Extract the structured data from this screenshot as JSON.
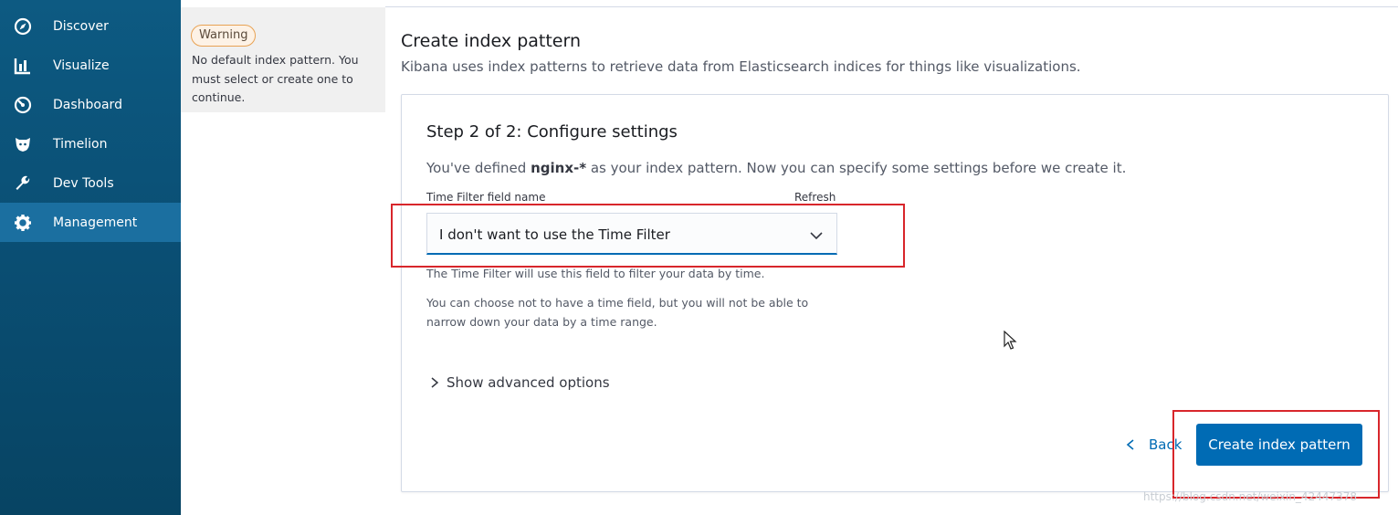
{
  "sidebar": {
    "items": [
      {
        "label": "Discover",
        "icon": "compass-icon",
        "active": false
      },
      {
        "label": "Visualize",
        "icon": "bar-chart-icon",
        "active": false
      },
      {
        "label": "Dashboard",
        "icon": "dashboard-icon",
        "active": false
      },
      {
        "label": "Timelion",
        "icon": "timelion-icon",
        "active": false
      },
      {
        "label": "Dev Tools",
        "icon": "wrench-icon",
        "active": false
      },
      {
        "label": "Management",
        "icon": "gear-icon",
        "active": true
      }
    ]
  },
  "warning": {
    "badge": "Warning",
    "message": "No default index pattern. You must select or create one to continue."
  },
  "header": {
    "title": "Create index pattern",
    "subtitle": "Kibana uses index patterns to retrieve data from Elasticsearch indices for things like visualizations."
  },
  "step": {
    "title": "Step 2 of 2: Configure settings",
    "desc_prefix": "You've defined ",
    "pattern": "nginx-*",
    "desc_suffix": " as your index pattern. Now you can specify some settings before we create it."
  },
  "time_filter": {
    "label": "Time Filter field name",
    "refresh": "Refresh",
    "selected": "I don't want to use the Time Filter",
    "help1": "The Time Filter will use this field to filter your data by time.",
    "help2": "You can choose not to have a time field, but you will not be able to narrow down your data by a time range."
  },
  "advanced_label": "Show advanced options",
  "buttons": {
    "back": "Back",
    "create": "Create index pattern"
  },
  "watermark": "https://blog.csdn.net/weixin_42447378",
  "colors": {
    "sidebar": "#0a4e73",
    "sidebar_active": "#1b6fa0",
    "primary": "#006bb4",
    "warning_border": "#e8a253",
    "annotation_red": "#d8262b"
  }
}
